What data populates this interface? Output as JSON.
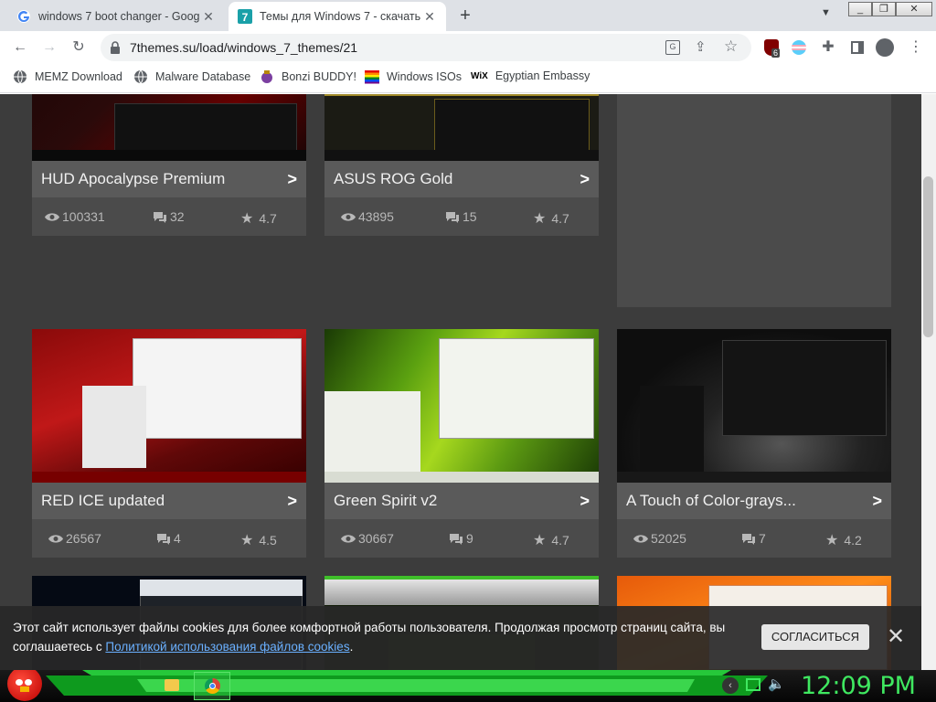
{
  "browser": {
    "tabs": [
      {
        "title": "windows 7 boot changer - Goog",
        "active": false
      },
      {
        "title": "Темы для Windows 7 - скачать",
        "active": true
      }
    ],
    "new_tab_label": "+",
    "tab_search_icon": "chevron-down-icon",
    "window_controls": [
      "minimize",
      "restore",
      "close"
    ],
    "url": "7themes.su/load/windows_7_themes/21",
    "extension_badge": "6",
    "bookmarks": [
      {
        "label": "MEMZ Download",
        "icon": "globe-icon"
      },
      {
        "label": "Malware Database",
        "icon": "globe-icon"
      },
      {
        "label": "Bonzi BUDDY!",
        "icon": "bonzi-icon"
      },
      {
        "label": "Windows ISOs",
        "icon": "windows-flag-icon"
      },
      {
        "label": "Egyptian Embassy",
        "icon": "wix-icon"
      }
    ]
  },
  "themes": [
    {
      "name": "HUD Apocalypse Premium",
      "views": "100331",
      "comments": "32",
      "rating": "4.7"
    },
    {
      "name": "ASUS ROG Gold",
      "views": "43895",
      "comments": "15",
      "rating": "4.7"
    },
    {
      "name": "RED ICE updated",
      "views": "26567",
      "comments": "4",
      "rating": "4.5"
    },
    {
      "name": "Green Spirit v2",
      "views": "30667",
      "comments": "9",
      "rating": "4.7"
    },
    {
      "name": "A Touch of Color-grays...",
      "views": "52025",
      "comments": "7",
      "rating": "4.2"
    }
  ],
  "cookie": {
    "text_before": "Этот сайт использует файлы cookies для более комфортной работы пользователя. Продолжая просмотр страниц сайта, вы соглашаетесь с ",
    "link": "Политикой использования файлов cookies",
    "text_after": ".",
    "agree": "СОГЛАСИТЬСЯ",
    "close": "✕"
  },
  "taskbar": {
    "clock": "12:09 PM"
  },
  "colors": {
    "page_bg": "#3c3c3c",
    "card_bg": "#4b4b4b",
    "clock": "#3fe860",
    "link": "#6ab0ff"
  }
}
